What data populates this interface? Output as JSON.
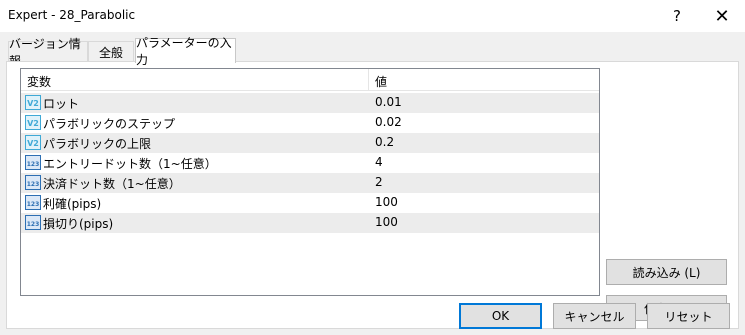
{
  "window": {
    "title": "Expert - 28_Parabolic",
    "help_glyph": "?",
    "close_glyph": "✕"
  },
  "tabs": [
    {
      "label": "バージョン情報"
    },
    {
      "label": "全般"
    },
    {
      "label": "パラメーターの入力",
      "active": true
    }
  ],
  "table": {
    "headers": {
      "name": "変数",
      "value": "値"
    },
    "rows": [
      {
        "icon": "v2-double-param-icon",
        "name": "ロット",
        "value": "0.01"
      },
      {
        "icon": "v2-double-param-icon",
        "name": "パラボリックのステップ",
        "value": "0.02"
      },
      {
        "icon": "v2-double-param-icon",
        "name": "パラボリックの上限",
        "value": "0.2"
      },
      {
        "icon": "123-int-param-icon",
        "name": "エントリードット数（1~任意）",
        "value": "4"
      },
      {
        "icon": "123-int-param-icon",
        "name": "決済ドット数（1~任意）",
        "value": "2"
      },
      {
        "icon": "123-int-param-icon",
        "name": "利確(pips)",
        "value": "100"
      },
      {
        "icon": "123-int-param-icon",
        "name": "損切り(pips)",
        "value": "100"
      }
    ]
  },
  "buttons": {
    "load": "読み込み (L)",
    "save": "保存 (S)",
    "ok": "OK",
    "cancel": "キャンセル",
    "reset": "リセット"
  },
  "colors": {
    "dialog_bg": "#f0f0f0",
    "alt_row": "#ececec",
    "focus_border": "#0078d7",
    "v2_icon": "#3fa9d6",
    "int_icon": "#2d6fb3"
  }
}
